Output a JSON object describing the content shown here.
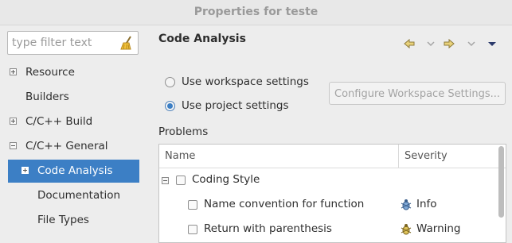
{
  "window": {
    "title": "Properties for teste"
  },
  "filter": {
    "placeholder": "type filter text"
  },
  "tree": [
    {
      "label": "Resource"
    },
    {
      "label": "Builders"
    },
    {
      "label": "C/C++ Build"
    },
    {
      "label": "C/C++ General"
    },
    {
      "label": "Code Analysis"
    },
    {
      "label": "Documentation"
    },
    {
      "label": "File Types"
    }
  ],
  "panel": {
    "title": "Code Analysis",
    "radio_workspace": "Use workspace settings",
    "radio_project": "Use project settings",
    "configure_button": "Configure Workspace Settings...",
    "problems_label": "Problems"
  },
  "table": {
    "col_name": "Name",
    "col_severity": "Severity",
    "rows": [
      {
        "name": "Coding Style",
        "severity": ""
      },
      {
        "name": "Name convention for function",
        "severity": "Info"
      },
      {
        "name": "Return with parenthesis",
        "severity": "Warning"
      }
    ]
  },
  "colors": {
    "selection": "#3c7fc5",
    "background": "#ededed"
  },
  "icons": [
    "broom-icon",
    "back-arrow-icon",
    "forward-arrow-icon",
    "dropdown-chevron-icon",
    "view-menu-icon",
    "info-bug-icon",
    "warning-bug-icon"
  ]
}
